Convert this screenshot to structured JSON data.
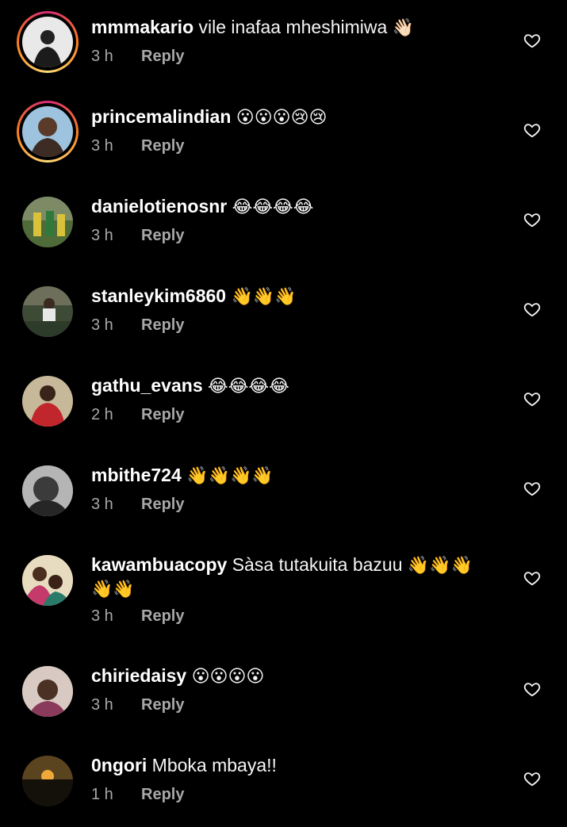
{
  "comments": [
    {
      "username": "mmmakario",
      "text": "vile inafaa mheshimiwa",
      "emoji": "👋🏻",
      "time": "3 h",
      "reply": "Reply",
      "story_ring": true
    },
    {
      "username": "princemalindian",
      "text": "",
      "emoji": "😮😮😮😢😢",
      "time": "3 h",
      "reply": "Reply",
      "story_ring": true
    },
    {
      "username": "danielotienosnr",
      "text": "",
      "emoji": "😂😂😂😂",
      "time": "3 h",
      "reply": "Reply",
      "story_ring": false
    },
    {
      "username": "stanleykim6860",
      "text": "",
      "emoji": "👋👋👋",
      "time": "3 h",
      "reply": "Reply",
      "story_ring": false
    },
    {
      "username": "gathu_evans",
      "text": "",
      "emoji": "😂😂😂😂",
      "time": "2 h",
      "reply": "Reply",
      "story_ring": false
    },
    {
      "username": "mbithe724",
      "text": "",
      "emoji": "👋👋👋👋",
      "time": "3 h",
      "reply": "Reply",
      "story_ring": false
    },
    {
      "username": "kawambuacopy",
      "text": "Sàsa tutakuita bazuu",
      "emoji": "👋👋👋 👋👋",
      "time": "3 h",
      "reply": "Reply",
      "story_ring": false
    },
    {
      "username": "chiriedaisy",
      "text": "",
      "emoji": "😮😮😮😮",
      "time": "3 h",
      "reply": "Reply",
      "story_ring": false
    },
    {
      "username": "0ngori",
      "text": "Mboka mbaya!!",
      "emoji": "",
      "time": "1 h",
      "reply": "Reply",
      "story_ring": false
    }
  ],
  "icons": {
    "like": "heart-outline-icon"
  },
  "colors": {
    "background": "#000000",
    "secondary_text": "#a8a8a8",
    "story_ring_start": "#d62976",
    "story_ring_end": "#feda75"
  }
}
